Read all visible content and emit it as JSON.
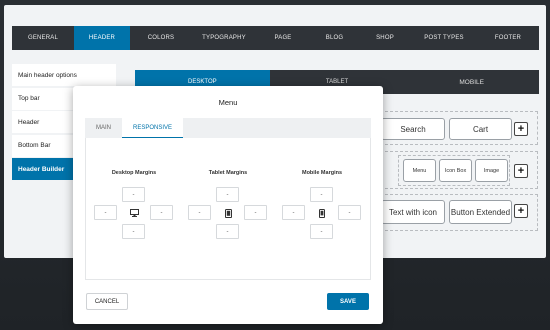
{
  "nav": {
    "items": [
      "GENERAL",
      "HEADER",
      "COLORS",
      "TYPOGRAPHY",
      "PAGE",
      "BLOG",
      "SHOP",
      "POST TYPES",
      "FOOTER"
    ],
    "active_index": 1
  },
  "sidebar": {
    "items": [
      "Main header options",
      "Top bar",
      "Header",
      "Bottom Bar",
      "Header Builder"
    ],
    "active_index": 4
  },
  "device_tabs": {
    "desktop": "DESKTOP",
    "tablet": "TABLET",
    "mobile": "MOBILE"
  },
  "builder": {
    "row1": {
      "search": "Search",
      "cart": "Cart"
    },
    "row2": {
      "menu": "Menu",
      "icon_box": "Icon Box",
      "image": "Image"
    },
    "row3": {
      "text_with_icon": "Text with icon",
      "button_extended": "Button Extended"
    },
    "plus": "+"
  },
  "modal": {
    "title": "Menu",
    "tabs": [
      "MAIN",
      "RESPONSIVE"
    ],
    "active_tab": 1,
    "groups": [
      {
        "label": "Desktop Margins",
        "icon": "desktop-icon"
      },
      {
        "label": "Tablet Margins",
        "icon": "tablet-icon"
      },
      {
        "label": "Mobile Margins",
        "icon": "mobile-icon"
      }
    ],
    "field_value": "-",
    "cancel": "CANCEL",
    "save": "SAVE"
  },
  "colors": {
    "accent": "#0073aa",
    "dark": "#2f3338"
  }
}
